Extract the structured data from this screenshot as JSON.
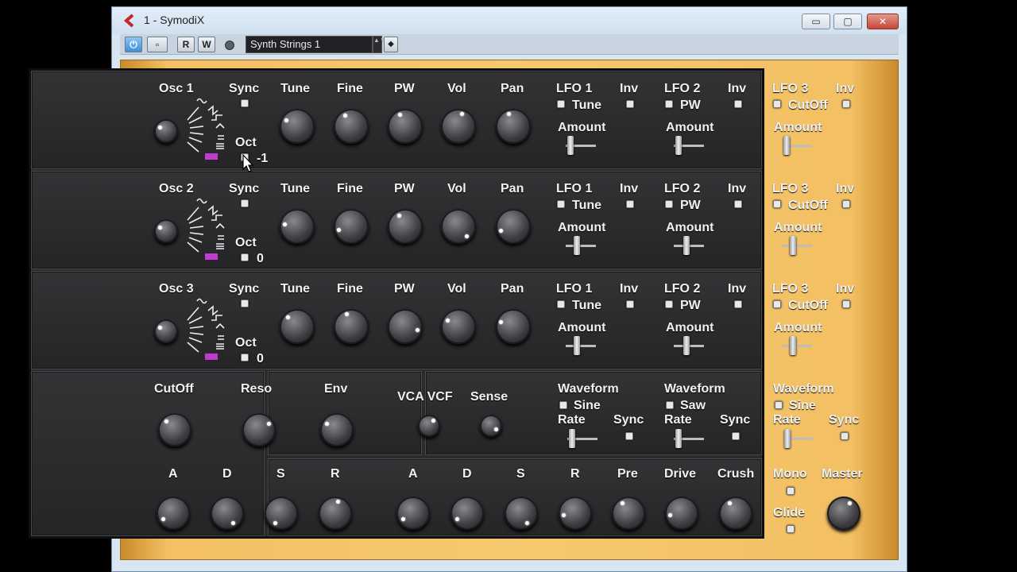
{
  "window": {
    "title": "1 - SymodiX",
    "min": "▭",
    "max": "▢",
    "close": "✕"
  },
  "toolbar": {
    "power": "⏻",
    "bypass": "▫",
    "r": "R",
    "w": "W",
    "preset": "Synth Strings 1",
    "spin": "▲▼",
    "menu": "◆"
  },
  "labels": {
    "sync": "Sync",
    "tune": "Tune",
    "fine": "Fine",
    "pw": "PW",
    "vol": "Vol",
    "pan": "Pan",
    "inv": "Inv",
    "amount": "Amount",
    "oct": "Oct",
    "lfo1": "LFO 1",
    "lfo2": "LFO 2",
    "lfo3": "LFO 3",
    "lfo_tune": "Tune",
    "lfo_pw": "PW",
    "lfo_cutoff": "CutOff"
  },
  "osc": [
    {
      "name": "Osc 1",
      "oct": "-1"
    },
    {
      "name": "Osc 2",
      "oct": "0"
    },
    {
      "name": "Osc 3",
      "oct": "0"
    }
  ],
  "filter": {
    "cutoff": "CutOff",
    "reso": "Reso",
    "env": "Env",
    "a": "A",
    "d": "D",
    "s": "S",
    "r": "R"
  },
  "vca": {
    "vcavcf": "VCA VCF",
    "sense": "Sense"
  },
  "lfo": [
    {
      "waveform": "Waveform",
      "wave": "Sine",
      "rate": "Rate",
      "sync": "Sync"
    },
    {
      "waveform": "Waveform",
      "wave": "Saw",
      "rate": "Rate",
      "sync": "Sync"
    },
    {
      "waveform": "Waveform",
      "wave": "Sine",
      "rate": "Rate",
      "sync": "Sync"
    }
  ],
  "amp": {
    "a": "A",
    "d": "D",
    "s": "S",
    "r": "R",
    "pre": "Pre",
    "drive": "Drive",
    "crush": "Crush",
    "mono": "Mono",
    "glide": "Glide",
    "master": "Master"
  },
  "colors": {
    "panel": "#2b2b2d",
    "frame": "#f3c063",
    "accent": "#c23bd0"
  }
}
